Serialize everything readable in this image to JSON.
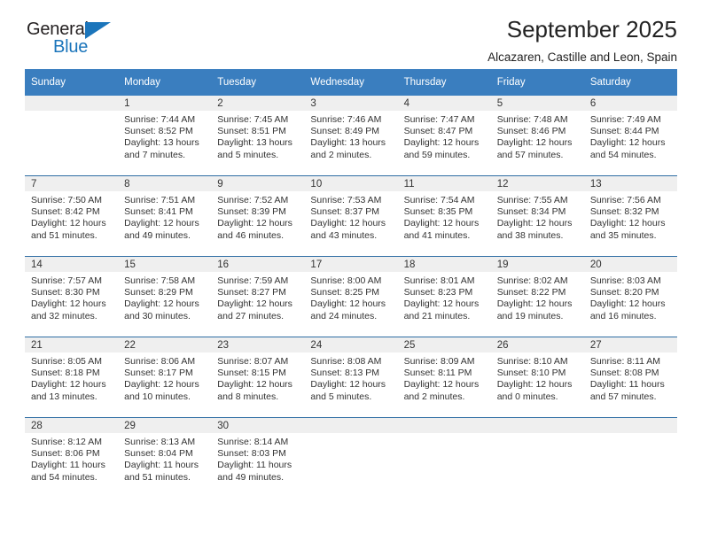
{
  "brand": {
    "name_part1": "General",
    "name_part2": "Blue",
    "triangle_color": "#1b75bb",
    "text_color": "#231f20"
  },
  "header": {
    "title": "September 2025",
    "subtitle": "Alcazaren, Castille and Leon, Spain"
  },
  "theme": {
    "header_row_bg": "#3a7ebf",
    "header_row_text": "#ffffff",
    "row_divider": "#2e6da4",
    "daynum_band_bg": "#efefef",
    "body_text": "#333333"
  },
  "calendar": {
    "weekday_headers": [
      "Sunday",
      "Monday",
      "Tuesday",
      "Wednesday",
      "Thursday",
      "Friday",
      "Saturday"
    ],
    "weeks": [
      [
        {
          "day": "",
          "sunrise": "",
          "sunset": "",
          "daylight": ""
        },
        {
          "day": "1",
          "sunrise": "Sunrise: 7:44 AM",
          "sunset": "Sunset: 8:52 PM",
          "daylight": "Daylight: 13 hours and 7 minutes."
        },
        {
          "day": "2",
          "sunrise": "Sunrise: 7:45 AM",
          "sunset": "Sunset: 8:51 PM",
          "daylight": "Daylight: 13 hours and 5 minutes."
        },
        {
          "day": "3",
          "sunrise": "Sunrise: 7:46 AM",
          "sunset": "Sunset: 8:49 PM",
          "daylight": "Daylight: 13 hours and 2 minutes."
        },
        {
          "day": "4",
          "sunrise": "Sunrise: 7:47 AM",
          "sunset": "Sunset: 8:47 PM",
          "daylight": "Daylight: 12 hours and 59 minutes."
        },
        {
          "day": "5",
          "sunrise": "Sunrise: 7:48 AM",
          "sunset": "Sunset: 8:46 PM",
          "daylight": "Daylight: 12 hours and 57 minutes."
        },
        {
          "day": "6",
          "sunrise": "Sunrise: 7:49 AM",
          "sunset": "Sunset: 8:44 PM",
          "daylight": "Daylight: 12 hours and 54 minutes."
        }
      ],
      [
        {
          "day": "7",
          "sunrise": "Sunrise: 7:50 AM",
          "sunset": "Sunset: 8:42 PM",
          "daylight": "Daylight: 12 hours and 51 minutes."
        },
        {
          "day": "8",
          "sunrise": "Sunrise: 7:51 AM",
          "sunset": "Sunset: 8:41 PM",
          "daylight": "Daylight: 12 hours and 49 minutes."
        },
        {
          "day": "9",
          "sunrise": "Sunrise: 7:52 AM",
          "sunset": "Sunset: 8:39 PM",
          "daylight": "Daylight: 12 hours and 46 minutes."
        },
        {
          "day": "10",
          "sunrise": "Sunrise: 7:53 AM",
          "sunset": "Sunset: 8:37 PM",
          "daylight": "Daylight: 12 hours and 43 minutes."
        },
        {
          "day": "11",
          "sunrise": "Sunrise: 7:54 AM",
          "sunset": "Sunset: 8:35 PM",
          "daylight": "Daylight: 12 hours and 41 minutes."
        },
        {
          "day": "12",
          "sunrise": "Sunrise: 7:55 AM",
          "sunset": "Sunset: 8:34 PM",
          "daylight": "Daylight: 12 hours and 38 minutes."
        },
        {
          "day": "13",
          "sunrise": "Sunrise: 7:56 AM",
          "sunset": "Sunset: 8:32 PM",
          "daylight": "Daylight: 12 hours and 35 minutes."
        }
      ],
      [
        {
          "day": "14",
          "sunrise": "Sunrise: 7:57 AM",
          "sunset": "Sunset: 8:30 PM",
          "daylight": "Daylight: 12 hours and 32 minutes."
        },
        {
          "day": "15",
          "sunrise": "Sunrise: 7:58 AM",
          "sunset": "Sunset: 8:29 PM",
          "daylight": "Daylight: 12 hours and 30 minutes."
        },
        {
          "day": "16",
          "sunrise": "Sunrise: 7:59 AM",
          "sunset": "Sunset: 8:27 PM",
          "daylight": "Daylight: 12 hours and 27 minutes."
        },
        {
          "day": "17",
          "sunrise": "Sunrise: 8:00 AM",
          "sunset": "Sunset: 8:25 PM",
          "daylight": "Daylight: 12 hours and 24 minutes."
        },
        {
          "day": "18",
          "sunrise": "Sunrise: 8:01 AM",
          "sunset": "Sunset: 8:23 PM",
          "daylight": "Daylight: 12 hours and 21 minutes."
        },
        {
          "day": "19",
          "sunrise": "Sunrise: 8:02 AM",
          "sunset": "Sunset: 8:22 PM",
          "daylight": "Daylight: 12 hours and 19 minutes."
        },
        {
          "day": "20",
          "sunrise": "Sunrise: 8:03 AM",
          "sunset": "Sunset: 8:20 PM",
          "daylight": "Daylight: 12 hours and 16 minutes."
        }
      ],
      [
        {
          "day": "21",
          "sunrise": "Sunrise: 8:05 AM",
          "sunset": "Sunset: 8:18 PM",
          "daylight": "Daylight: 12 hours and 13 minutes."
        },
        {
          "day": "22",
          "sunrise": "Sunrise: 8:06 AM",
          "sunset": "Sunset: 8:17 PM",
          "daylight": "Daylight: 12 hours and 10 minutes."
        },
        {
          "day": "23",
          "sunrise": "Sunrise: 8:07 AM",
          "sunset": "Sunset: 8:15 PM",
          "daylight": "Daylight: 12 hours and 8 minutes."
        },
        {
          "day": "24",
          "sunrise": "Sunrise: 8:08 AM",
          "sunset": "Sunset: 8:13 PM",
          "daylight": "Daylight: 12 hours and 5 minutes."
        },
        {
          "day": "25",
          "sunrise": "Sunrise: 8:09 AM",
          "sunset": "Sunset: 8:11 PM",
          "daylight": "Daylight: 12 hours and 2 minutes."
        },
        {
          "day": "26",
          "sunrise": "Sunrise: 8:10 AM",
          "sunset": "Sunset: 8:10 PM",
          "daylight": "Daylight: 12 hours and 0 minutes."
        },
        {
          "day": "27",
          "sunrise": "Sunrise: 8:11 AM",
          "sunset": "Sunset: 8:08 PM",
          "daylight": "Daylight: 11 hours and 57 minutes."
        }
      ],
      [
        {
          "day": "28",
          "sunrise": "Sunrise: 8:12 AM",
          "sunset": "Sunset: 8:06 PM",
          "daylight": "Daylight: 11 hours and 54 minutes."
        },
        {
          "day": "29",
          "sunrise": "Sunrise: 8:13 AM",
          "sunset": "Sunset: 8:04 PM",
          "daylight": "Daylight: 11 hours and 51 minutes."
        },
        {
          "day": "30",
          "sunrise": "Sunrise: 8:14 AM",
          "sunset": "Sunset: 8:03 PM",
          "daylight": "Daylight: 11 hours and 49 minutes."
        },
        {
          "day": "",
          "sunrise": "",
          "sunset": "",
          "daylight": ""
        },
        {
          "day": "",
          "sunrise": "",
          "sunset": "",
          "daylight": ""
        },
        {
          "day": "",
          "sunrise": "",
          "sunset": "",
          "daylight": ""
        },
        {
          "day": "",
          "sunrise": "",
          "sunset": "",
          "daylight": ""
        }
      ]
    ]
  }
}
